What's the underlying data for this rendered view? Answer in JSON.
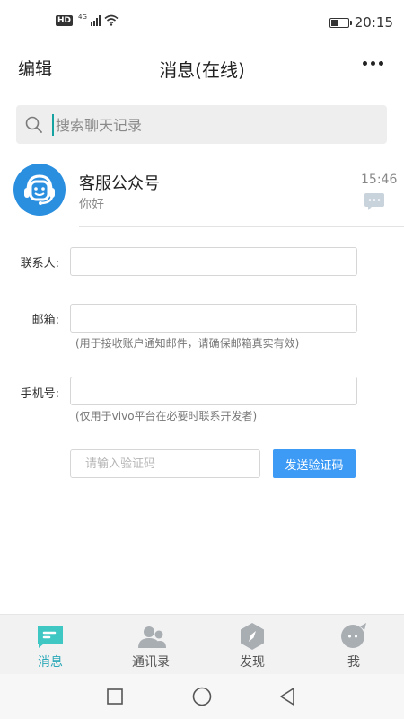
{
  "status_bar": {
    "left_badge": "HD",
    "network": "4G",
    "battery_level": 0.35,
    "time": "20:15"
  },
  "header": {
    "edit_label": "编辑",
    "title": "消息(在线)",
    "more_icon": "more-dots-icon"
  },
  "search": {
    "placeholder": "搜索聊天记录",
    "icon": "search-icon"
  },
  "chat": {
    "name": "客服公众号",
    "message": "你好",
    "time": "15:46",
    "avatar_icon": "headset-robot-icon",
    "bubble_icon": "chat-bubble-icon"
  },
  "form": {
    "contact_label": "联系人:",
    "contact_value": "",
    "email_label": "邮箱:",
    "email_value": "",
    "email_hint": "(用于接收账户通知邮件，请确保邮箱真实有效)",
    "phone_label": "手机号:",
    "phone_value": "",
    "phone_hint": "(仅用于vivo平台在必要时联系开发者)",
    "code_placeholder": "请输入验证码",
    "send_code_label": "发送验证码"
  },
  "bottom_nav": {
    "items": [
      {
        "label": "消息",
        "icon": "message-icon",
        "active": true
      },
      {
        "label": "通讯录",
        "icon": "contacts-icon",
        "active": false
      },
      {
        "label": "发现",
        "icon": "compass-icon",
        "active": false
      },
      {
        "label": "我",
        "icon": "me-icon",
        "active": false
      }
    ]
  },
  "system_nav": {
    "recent": "recent-apps-icon",
    "home": "home-icon",
    "back": "back-icon"
  },
  "colors": {
    "accent": "#3d9bf5",
    "avatar": "#2b8fe0",
    "active_tab": "#2aa8b8"
  }
}
